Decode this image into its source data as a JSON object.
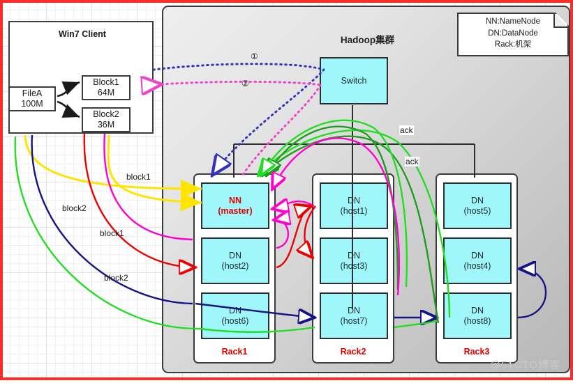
{
  "client": {
    "title": "Win7 Client",
    "file": {
      "name": "FileA",
      "size": "100M"
    },
    "blocks": [
      {
        "name": "Block1",
        "size": "64M"
      },
      {
        "name": "Block2",
        "size": "36M"
      }
    ]
  },
  "cluster": {
    "title": "Hadoop集群",
    "switch_label": "Switch",
    "legend": {
      "line1": "NN:NameNode",
      "line2": "DN:DataNode",
      "line3": "Rack:机架"
    },
    "racks": [
      {
        "label": "Rack1",
        "nodes": [
          {
            "line1": "NN",
            "line2": "(master)",
            "master": true
          },
          {
            "line1": "DN",
            "line2": "(host2)",
            "master": false
          },
          {
            "line1": "DN",
            "line2": "(host6)",
            "master": false
          }
        ]
      },
      {
        "label": "Rack2",
        "nodes": [
          {
            "line1": "DN",
            "line2": "(host1)",
            "master": false
          },
          {
            "line1": "DN",
            "line2": "(host3)",
            "master": false
          },
          {
            "line1": "DN",
            "line2": "(host7)",
            "master": false
          }
        ]
      },
      {
        "label": "Rack3",
        "nodes": [
          {
            "line1": "DN",
            "line2": "(host5)",
            "master": false
          },
          {
            "line1": "DN",
            "line2": "(host4)",
            "master": false
          },
          {
            "line1": "DN",
            "line2": "(host8)",
            "master": false
          }
        ]
      }
    ]
  },
  "annotations": {
    "step1": "①",
    "step2": "②",
    "block1_yellow": "block1",
    "block2_yellow": "block2",
    "block1_red": "block1",
    "block2_navy": "block2",
    "ack1": "ack",
    "ack2": "ack"
  },
  "colors": {
    "border_red": "#ff2a2a",
    "node_fill": "#9ff7fb",
    "master_text": "#e00000",
    "rack_text": "#e00000",
    "blue_dotted": "#3333bb",
    "magenta_dotted": "#ee44cc",
    "yellow": "#ffe400",
    "magenta": "#ff00d0",
    "red": "#ee0000",
    "navy": "#141486",
    "green_bright": "#22dd22",
    "green_dark": "#1f9d1f"
  },
  "watermark": "@51CTO博客"
}
